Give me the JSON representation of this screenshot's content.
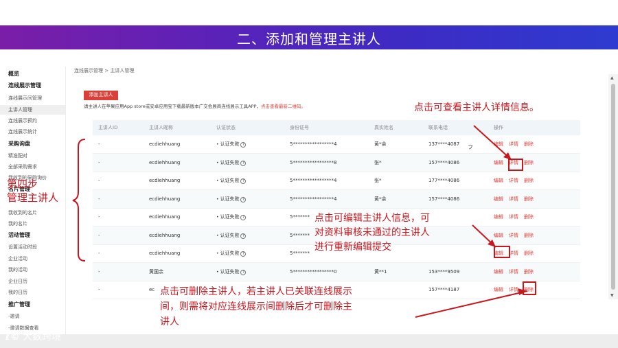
{
  "banner": {
    "title": "二、添加和管理主讲人"
  },
  "sidebar": {
    "items": [
      {
        "label": "概览",
        "type": "head"
      },
      {
        "label": "连线展示管理",
        "type": "head"
      },
      {
        "label": "连线展示间管理",
        "type": "item"
      },
      {
        "label": "主讲人管理",
        "type": "active"
      },
      {
        "label": "连线展示预约",
        "type": "item"
      },
      {
        "label": "连线展示统计",
        "type": "item"
      },
      {
        "label": "采购询盘",
        "type": "head"
      },
      {
        "label": "精准配对",
        "type": "item"
      },
      {
        "label": "全部采购需求",
        "type": "item"
      },
      {
        "label": "我收到的采购询价",
        "type": "item"
      },
      {
        "label": "名片管理",
        "type": "head"
      },
      {
        "label": "我收到的名片",
        "type": "item"
      },
      {
        "label": "我的名片",
        "type": "item"
      },
      {
        "label": "活动管理",
        "type": "head"
      },
      {
        "label": "设置活动时段",
        "type": "item"
      },
      {
        "label": "企业活动",
        "type": "item"
      },
      {
        "label": "我的活动",
        "type": "item"
      },
      {
        "label": "企业日历",
        "type": "item"
      },
      {
        "label": "我的日历",
        "type": "item"
      },
      {
        "label": "推广管理",
        "type": "head"
      },
      {
        "label": "-邀请",
        "type": "item"
      },
      {
        "label": "-邀请数据查看",
        "type": "item"
      }
    ]
  },
  "main": {
    "breadcrumb": "连线展示管理 > 主讲人管理",
    "add_button": "添加主讲人",
    "notice": "请主讲人在苹果应用App store或安卓应用宝下载最新版本广交会展商连线展示工具APP，",
    "notice_link": "点击查看最新二维码。",
    "columns": [
      "主讲人ID",
      "主讲人昵称",
      "认证状态",
      "身份证号",
      "真实姓名",
      "联系电话",
      "操作"
    ],
    "rows": [
      {
        "id": "-",
        "nickname": "ecdiehhuang",
        "status": "认证失败",
        "id_no": "5*****************4",
        "name": "黄*余",
        "phone": "137****4087"
      },
      {
        "id": "-",
        "nickname": "ecdiehhuang",
        "status": "认证失败",
        "id_no": "5*****************8",
        "name": "张*",
        "phone": "157****4086"
      },
      {
        "id": "-",
        "nickname": "ecdiehhuang",
        "status": "认证失败",
        "id_no": "5*****************4",
        "name": "张*",
        "phone": "177****4086"
      },
      {
        "id": "-",
        "nickname": "ecdiehhuang",
        "status": "认证失败",
        "id_no": "5*****************4",
        "name": "黄*余",
        "phone": "157****4086"
      },
      {
        "id": "-",
        "nickname": "ecdiehhuang",
        "status": "认证失败",
        "id_no": "5*******",
        "name": "",
        "phone": ""
      },
      {
        "id": "-",
        "nickname": "ecdiehhuang",
        "status": "认证失败",
        "id_no": "5*******",
        "name": "",
        "phone": ""
      },
      {
        "id": "-",
        "nickname": "ecdiehhuang",
        "status": "认证失败",
        "id_no": "5*******",
        "name": "",
        "phone": ""
      },
      {
        "id": "-",
        "nickname": "黄国余",
        "status": "认证失败",
        "id_no": "5*****************0",
        "name": "黄**1",
        "phone": "153****9509"
      },
      {
        "id": "-",
        "nickname": "ec",
        "status": "",
        "id_no": "",
        "name": "",
        "phone": "157****4187"
      }
    ],
    "ops": {
      "edit": "编辑",
      "detail": "详情",
      "delete": "删除"
    }
  },
  "annotations": {
    "detail": "点击可查看主讲人详情信息。",
    "edit": [
      "点击可编辑主讲人信息，可",
      "对资料审核未通过的主讲人",
      "进行重新编辑提交"
    ],
    "delete": [
      "点击可删除主讲人，若主讲人已关联连线展示",
      "间，则需将对应连线展示间删除后才可删除主",
      "讲人"
    ],
    "step": [
      "第四步",
      "管理主讲人"
    ],
    "stray_mark": "フ"
  },
  "footer": {
    "logo_mark": "ℓ©",
    "logo_text": "大数跨境"
  },
  "colors": {
    "accent": "#d9403a",
    "annotation": "#c8161d",
    "banner_start": "#7a1ea8",
    "banner_end": "#2e3bd0"
  }
}
